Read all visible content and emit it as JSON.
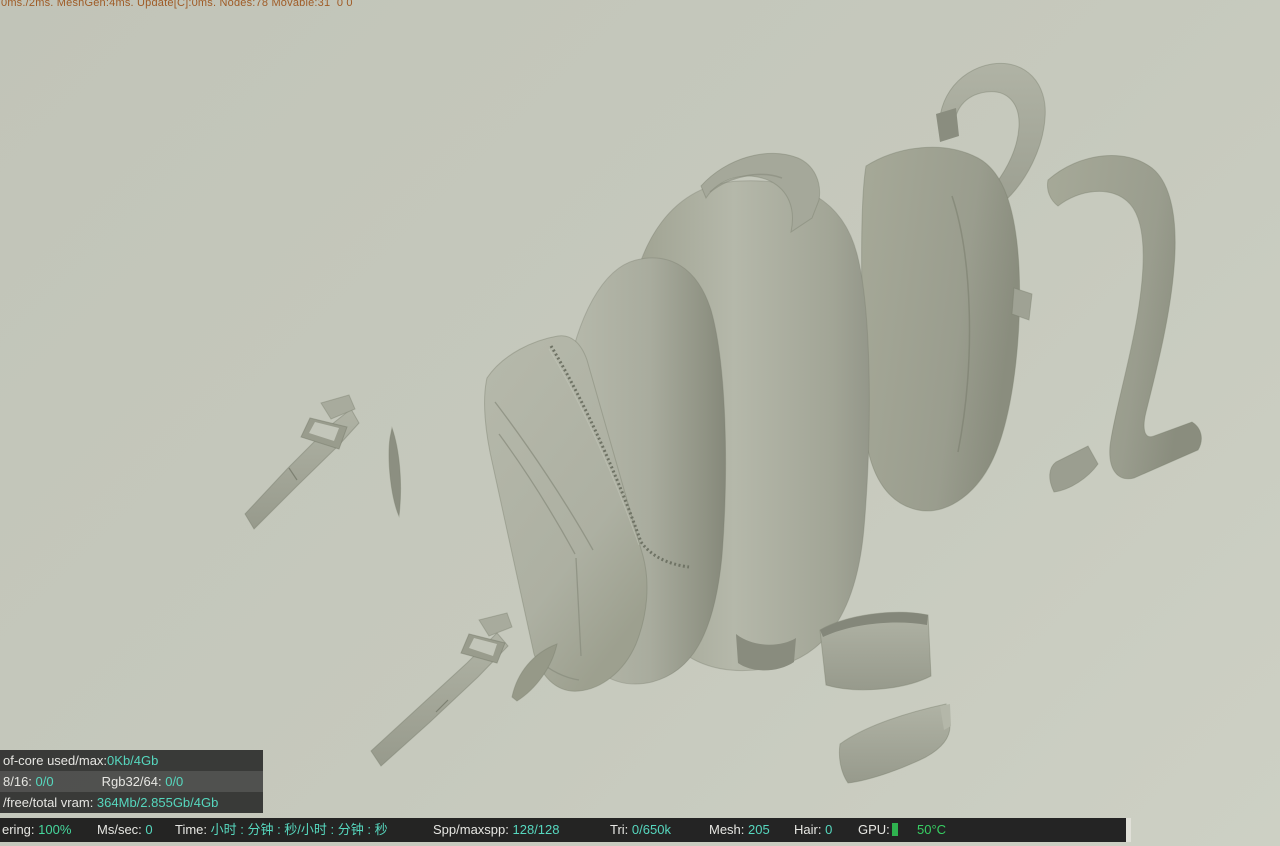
{
  "viewport": {
    "description": "GPU render viewport showing an exploded clay render of a backpack model"
  },
  "debug_overlay": {
    "text": "0ms./2ms. MeshGen:4ms. Update[C]:0ms. Nodes:78 Movable:31  0 0"
  },
  "memory_panel": {
    "row1_label": "of-core used/max:",
    "row1_value": "0Kb/4Gb",
    "row2_label1": "8/16: ",
    "row2_value1": "0/0",
    "row2_label2": "Rgb32/64: ",
    "row2_value2": "0/0",
    "row3_label": "/free/total vram: ",
    "row3_value": "364Mb/2.855Gb/4Gb"
  },
  "status_bar": {
    "rendering_label": "ering: ",
    "rendering_value": "100%",
    "mssec_label": "Ms/sec: ",
    "mssec_value": "0",
    "time_label": "Time: ",
    "time_value": "小时 : 分钟 : 秒/小时 : 分钟 : 秒",
    "spp_label": "Spp/maxspp: ",
    "spp_value": "128/128",
    "tri_label": "Tri: ",
    "tri_value": "0/650k",
    "mesh_label": "Mesh: ",
    "mesh_value": "205",
    "hair_label": "Hair: ",
    "hair_value": "0",
    "gpu_label": "GPU:",
    "temp_value": "50°C"
  },
  "colors": {
    "value_teal": "#56d7be",
    "status_green": "#45d79c",
    "temp_green": "#37cf63",
    "gpu_green": "#2fb24f",
    "label_light": "#e6e6e2",
    "debug_orange": "#9f5b26",
    "panel_dark": "rgba(38,38,38,0.88)",
    "panel_mid": "rgba(64,64,64,0.88)",
    "bar_dark": "rgba(26,26,26,0.94)"
  }
}
